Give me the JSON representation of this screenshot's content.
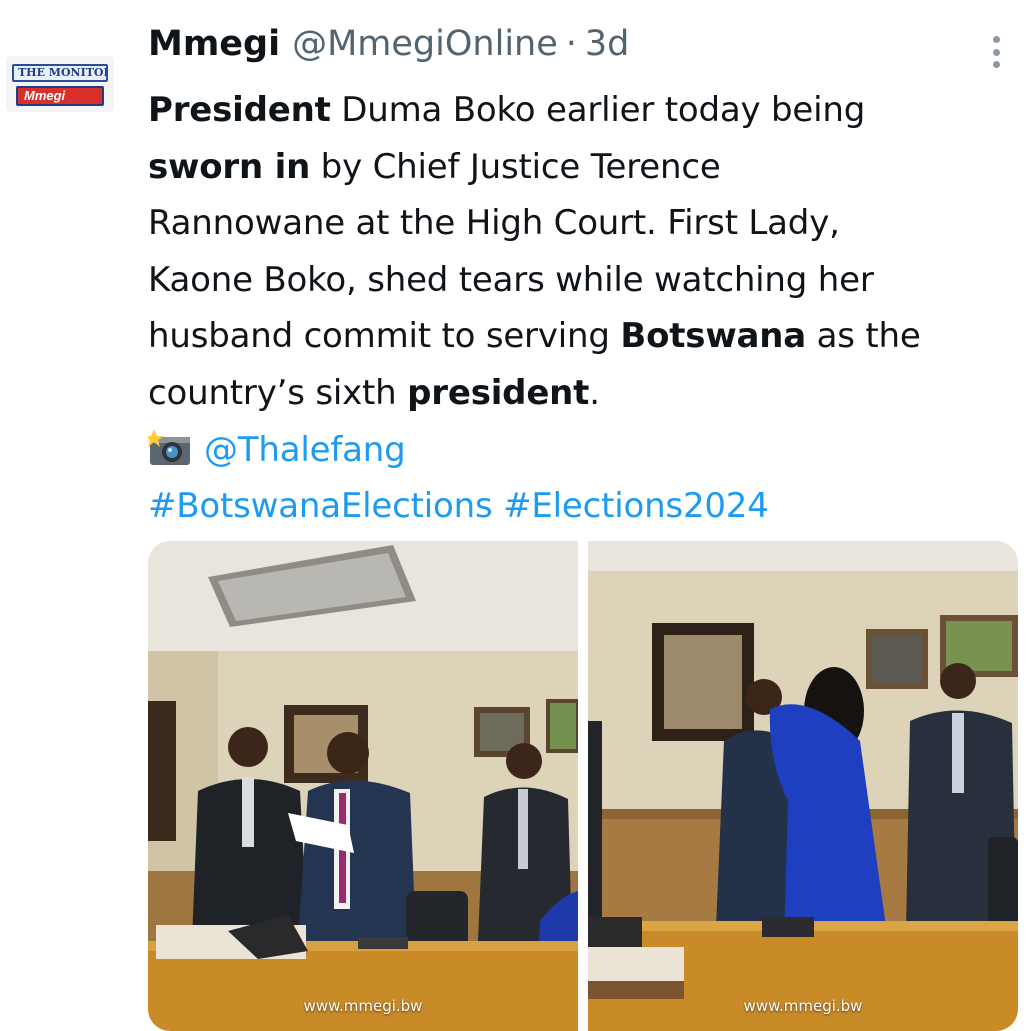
{
  "tweet": {
    "author_name": "Mmegi",
    "handle": "@MmegiOnline",
    "separator": "·",
    "time": "3d",
    "avatar": {
      "line1": "THE MONITOR",
      "line2": "Mmegi"
    },
    "text": {
      "p1_bold": "President",
      "p1_rest": " Duma Boko earlier today being",
      "p2_bold": "sworn in",
      "p2_rest": " by Chief Justice Terence",
      "p3": "Rannowane at the High Court. First Lady,",
      "p4": "Kaone Boko, shed tears while watching her",
      "p5_pre": "husband commit to serving ",
      "p5_bold": "Botswana",
      "p5_post": " as the",
      "p6_pre": "country’s sixth ",
      "p6_bold": "president",
      "p6_post": "."
    },
    "photo_credit": "@Thalefang",
    "hashtags": [
      "#BotswanaElections",
      "#Elections2024"
    ],
    "media": [
      {
        "watermark": "www.mmegi.bw"
      },
      {
        "watermark": "www.mmegi.bw"
      }
    ]
  },
  "icons": [
    "more-options-icon",
    "camera-flash-icon"
  ],
  "colors": {
    "link": "#1d9bf0",
    "secondary_text": "#536471",
    "text": "#0f1419"
  }
}
